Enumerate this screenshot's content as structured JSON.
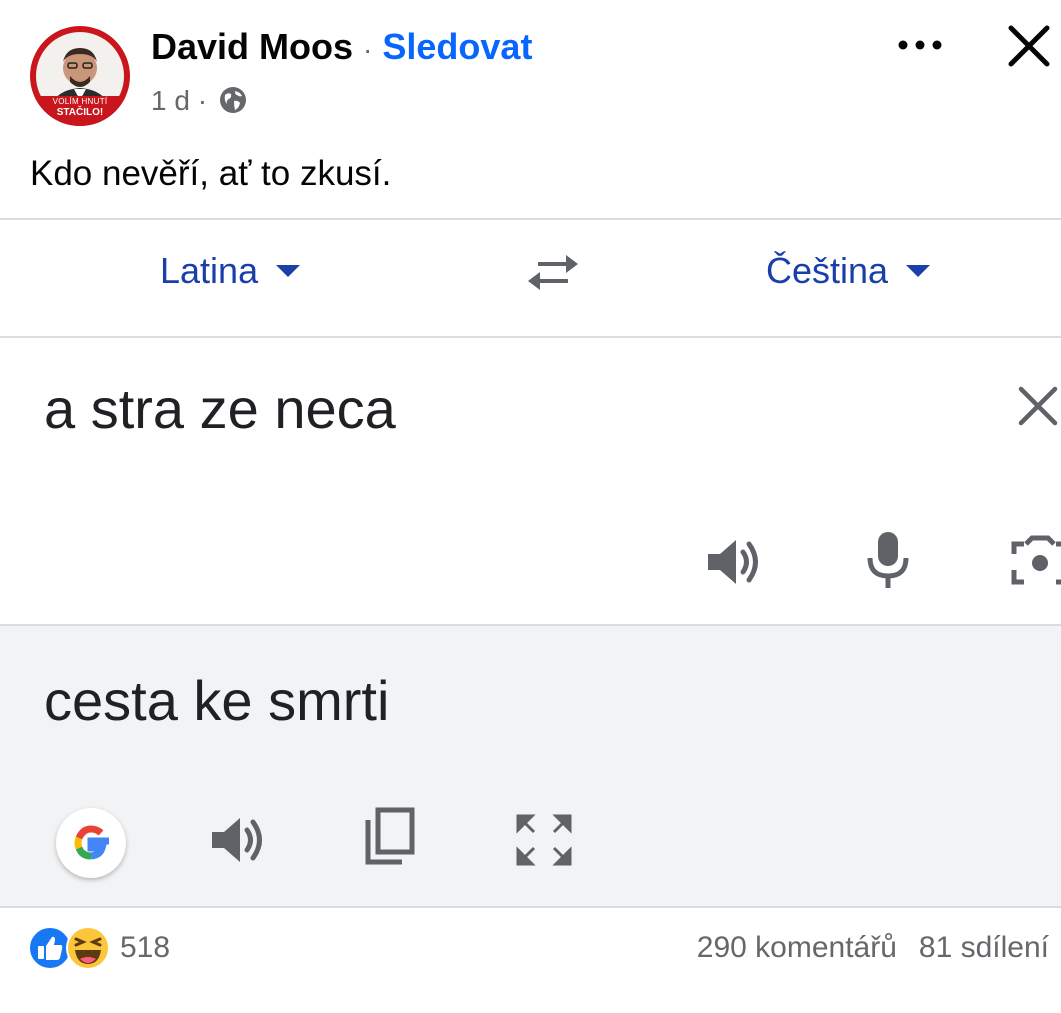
{
  "post": {
    "author": "David Moos",
    "separator": "·",
    "follow_label": "Sledovat",
    "time": "1 d ·",
    "caption": "Kdo nevěří, ať to zkusí.",
    "avatar": {
      "ribbon_line1": "VOLÍM HNUTÍ",
      "ribbon_line2": "STAČILO!"
    }
  },
  "translate": {
    "source_language": "Latina",
    "target_language": "Čeština",
    "source_text": "a stra ze neca",
    "target_text": "cesta ke smrti",
    "colors": {
      "language_label": "#1a3faa",
      "result_background": "#f1f3f4",
      "icon_gray": "#5f6368"
    },
    "icons": [
      "swap-icon",
      "clear-icon",
      "speaker-icon",
      "mic-icon",
      "camera-icon",
      "google-logo",
      "copy-icon",
      "fullscreen-icon"
    ]
  },
  "footer": {
    "reaction_count": "518",
    "comments": "290 komentářů",
    "shares": "81 sdílení",
    "reaction_icons": [
      "like-icon",
      "haha-icon"
    ]
  },
  "colors": {
    "follow_blue": "#0866ff",
    "secondary_text": "#65676b"
  }
}
